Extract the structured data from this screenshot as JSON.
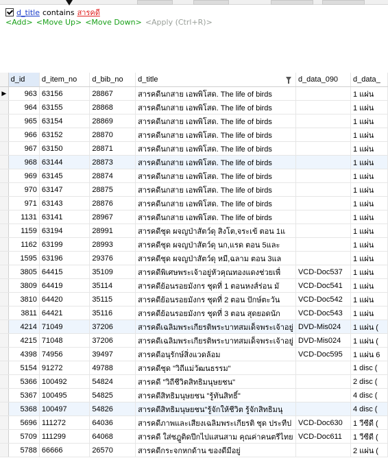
{
  "filter": {
    "field": "d_title",
    "operator": "contains",
    "value": "สารคดี"
  },
  "actions": {
    "add": "<Add>",
    "move_up": "<Move Up>",
    "move_down": "<Move Down>",
    "apply": "<Apply (Ctrl+R)>"
  },
  "grid": {
    "columns": [
      "d_id",
      "d_item_no",
      "d_bib_no",
      "d_title",
      "d_data_090",
      "d_data_"
    ],
    "rows": [
      [
        "963",
        "63156",
        "28867",
        "สารคดีนกสาย เอพพิโสด. The life of birds",
        "",
        "1 แผ่น"
      ],
      [
        "964",
        "63155",
        "28868",
        "สารคดีนกสาย เอพพิโสด. The life of birds",
        "",
        "1 แผ่น"
      ],
      [
        "965",
        "63154",
        "28869",
        "สารคดีนกสาย เอพพิโสด. The life of birds",
        "",
        "1 แผ่น"
      ],
      [
        "966",
        "63152",
        "28870",
        "สารคดีนกสาย เอพพิโสด. The life of birds",
        "",
        "1 แผ่น"
      ],
      [
        "967",
        "63150",
        "28871",
        "สารคดีนกสาย เอพพิโสด. The life of birds",
        "",
        "1 แผ่น"
      ],
      [
        "968",
        "63144",
        "28873",
        "สารคดีนกสาย เอพพิโสด. The life of birds",
        "",
        "1 แผ่น"
      ],
      [
        "969",
        "63145",
        "28874",
        "สารคดีนกสาย เอพพิโสด. The life of birds",
        "",
        "1 แผ่น"
      ],
      [
        "970",
        "63147",
        "28875",
        "สารคดีนกสาย เอพพิโสด. The life of birds",
        "",
        "1 แผ่น"
      ],
      [
        "971",
        "63143",
        "28876",
        "สารคดีนกสาย เอพพิโสด. The life of birds",
        "",
        "1 แผ่น"
      ],
      [
        "1131",
        "63141",
        "28967",
        "สารคดีนกสาย เอพพิโสด. The life of birds",
        "",
        "1 แผ่น"
      ],
      [
        "1159",
        "63194",
        "28991",
        "สารคดีชุด ผจญป่าสัตว์ดุ สิงโต,จระเข้ ตอน 1แ",
        "",
        "1 แผ่น"
      ],
      [
        "1162",
        "63199",
        "28993",
        "สารคดีชุด ผจญป่าสัตว์ดุ นก,แรด ตอน 5และ",
        "",
        "1 แผ่น"
      ],
      [
        "1595",
        "63196",
        "29376",
        "สารคดีชุด ผจญป่าสัตว์ดุ หมี,ฉลาม ตอน 3แล",
        "",
        "1 แผ่น"
      ],
      [
        "3805",
        "64415",
        "35109",
        "สารคดีพิเศษพระเจ้าอยู่หัวคุณทองแดงช่วยเพื่",
        "VCD-Doc537",
        "1 แผ่น"
      ],
      [
        "3809",
        "64419",
        "35114",
        "สารคดีย้อนรอยมังกร ชุดที่ 1 ตอนหงส์ร่อน มั",
        "VCD-Doc541",
        "1 แผ่น"
      ],
      [
        "3810",
        "64420",
        "35115",
        "สารคดีย้อนรอยมังกร ชุดที่ 2 ตอน ปักษ์ตะวัน",
        "VCD-Doc542",
        "1 แผ่น"
      ],
      [
        "3811",
        "64421",
        "35116",
        "สารคดีย้อนรอยมังกร ชุดที่ 3 ตอน สุดยอดนัก",
        "VCD-Doc543",
        "1 แผ่น"
      ],
      [
        "4214",
        "71049",
        "37206",
        "สารคดีเฉลิมพระเกียรติพระบาทสมเด็จพระเจ้าอยู่",
        "DVD-Mis024",
        "1 แผ่น ("
      ],
      [
        "4215",
        "71048",
        "37206",
        "สารคดีเฉลิมพระเกียรติพระบาทสมเด็จพระเจ้าอยู่",
        "DVD-Mis024",
        "1 แผ่น ("
      ],
      [
        "4398",
        "74956",
        "39497",
        "สารคดีอนุรักษ์สิ่งแวดล้อม",
        "VCD-Doc595",
        "1 แผ่น 6"
      ],
      [
        "5154",
        "91272",
        "49788",
        "สารคดีชุด \"วิถีแม่วัฒนธรรม\"",
        "",
        "1 disc ("
      ],
      [
        "5366",
        "100492",
        "54824",
        "สารคดี \"วิถีชีวิตสิทธิมนุษยชน\"",
        "",
        "2 disc ("
      ],
      [
        "5367",
        "100495",
        "54825",
        "สารคดีสิทธิมนุษยชน \"รู้ทันสิทธิ์\"",
        "",
        "4 disc ("
      ],
      [
        "5368",
        "100497",
        "54826",
        "สารคดีสิทธิมนุษยชน\"รู้จักให้ชีวิต รู้จักสิทธิมนุ",
        "",
        "4 disc ("
      ],
      [
        "5696",
        "111272",
        "64036",
        "สารคดีภาพและเสียงเฉลิมพระเกียรติ ชุด ประทีป",
        "VCD-Doc630",
        "1 วีซีดี ("
      ],
      [
        "5709",
        "111299",
        "64068",
        "สารคดี ใส่ชฎูติดปีกไปแสนสาม คุณค่าคนตรีไทย",
        "VCD-Doc611",
        "1 วีซีดี ("
      ],
      [
        "5788",
        "66666",
        "26570",
        "สารคดีกระจกหกด้าน ของดีมีอยู่",
        "",
        "2 แผ่น ("
      ]
    ]
  }
}
